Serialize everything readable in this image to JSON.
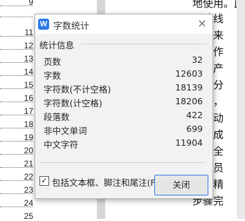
{
  "line_numbers": [
    "9",
    "11",
    "12",
    "13",
    "14",
    "15",
    "16",
    "17",
    "18",
    "19",
    "20",
    "21",
    "22",
    "23",
    "24",
    "25"
  ],
  "document_lines": [
    "地使用。此",
    "马达线",
    "产出来",
    "可操作",
    "来的产",
    "的部分",
    "困难，",
    "半自动",
    "最为成",
    "格比全",
    "操作员",
    "伺服精",
    "步骤完"
  ],
  "dialog": {
    "title": "字数统计",
    "app_icon": "W",
    "close_glyph": "×",
    "section_title": "统计信息",
    "stats": [
      {
        "label": "页数",
        "value": "32"
      },
      {
        "label": "字数",
        "value": "12603"
      },
      {
        "label": "字符数(不计空格)",
        "value": "18139"
      },
      {
        "label": "字符数(计空格)",
        "value": "18206"
      },
      {
        "label": "段落数",
        "value": "422"
      },
      {
        "label": "非中文单词",
        "value": "699"
      },
      {
        "label": "中文字符",
        "value": "11904"
      }
    ],
    "checkbox_label": "包括文本框、脚注和尾注(F)",
    "checkbox_mark": "✓",
    "close_button": "关闭"
  }
}
